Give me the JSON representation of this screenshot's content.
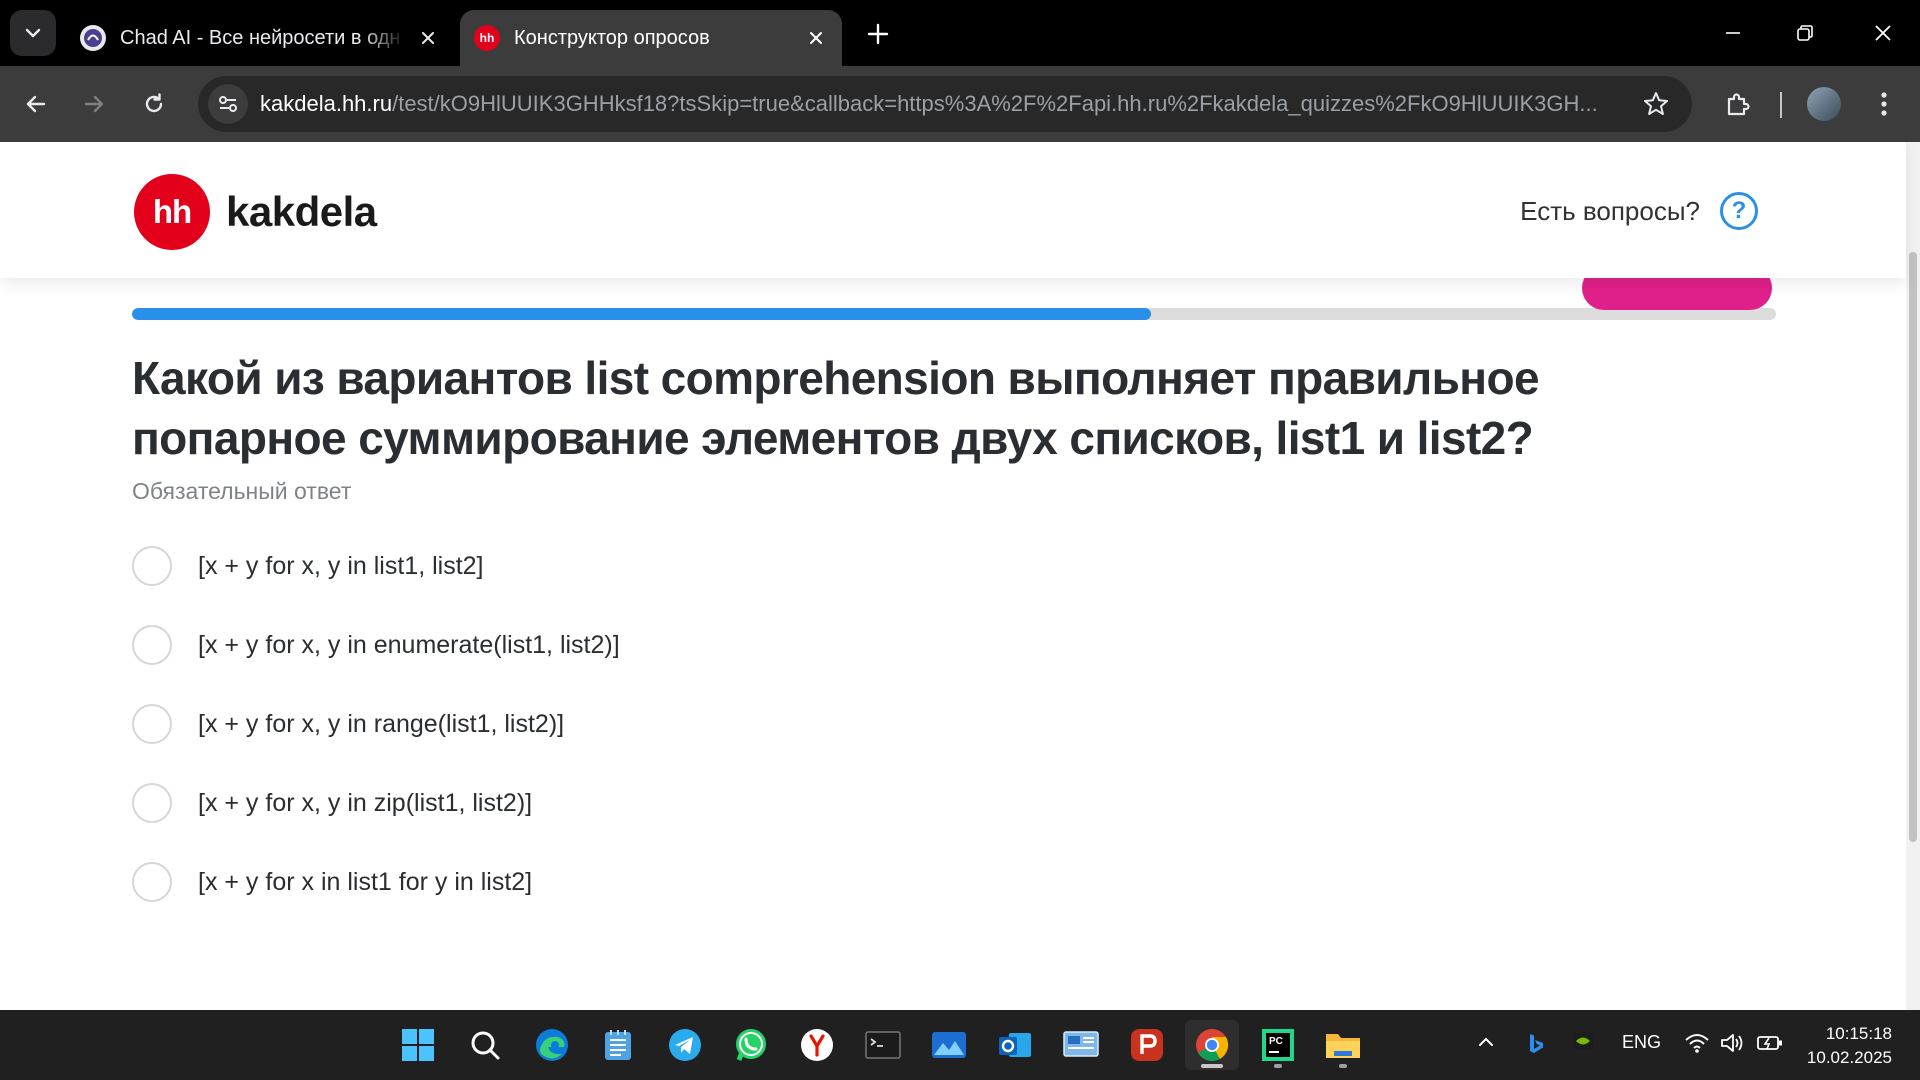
{
  "tabs": [
    {
      "title": "Chad AI - Все нейросети в одн",
      "active": false,
      "favicon": "chad-ai-icon"
    },
    {
      "title": "Конструктор опросов",
      "active": true,
      "favicon_text": "hh"
    }
  ],
  "address_bar": {
    "host": "kakdela.hh.ru",
    "path": "/test/kO9HlUUIK3GHHksf18?tsSkip=true&callback=https%3A%2F%2Fapi.hh.ru%2Fkakdela_quizzes%2FkO9HlUUIK3GH..."
  },
  "site": {
    "logo_mark": "hh",
    "logo_name": "kakdela",
    "help_text": "Есть вопросы?",
    "help_icon": "?"
  },
  "quiz": {
    "progress": 0.62,
    "question": "Какой из вариантов list comprehension выполняет правильное попарное суммирование элементов двух списков, list1 и list2?",
    "required_note": "Обязательный ответ",
    "options": [
      "[x + y for x, y in list1, list2]",
      "[x + y for x, y in enumerate(list1, list2)]",
      "[x + y for x, y in range(list1, list2)]",
      "[x + y for x, y in zip(list1, list2)]",
      "[x + y for x in list1 for y in list2]"
    ]
  },
  "taskbar": {
    "apps": [
      "windows-start-icon",
      "search-icon",
      "edge-icon",
      "notepad-icon",
      "telegram-icon",
      "whatsapp-icon",
      "yandex-browser-icon",
      "terminal-icon",
      "photos-icon",
      "outlook-icon",
      "control-panel-icon",
      "pascal-icon",
      "chrome-icon",
      "pycharm-icon",
      "file-explorer-icon"
    ],
    "active_app": "chrome-icon",
    "language": "ENG",
    "time": "10:15:18",
    "date": "10.02.2025"
  },
  "colors": {
    "brand_red": "#e3001b",
    "progress_blue": "#2a8fe8",
    "pink_button": "#e0208a"
  }
}
